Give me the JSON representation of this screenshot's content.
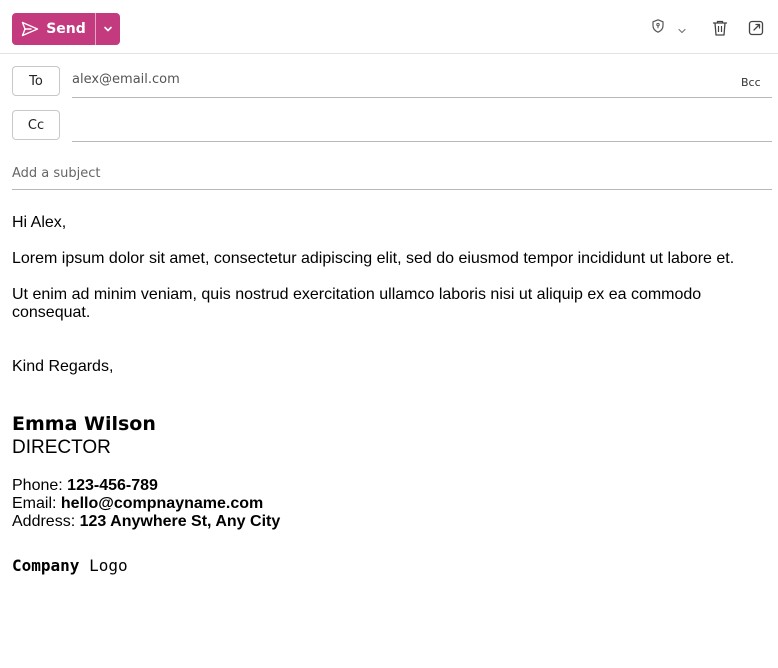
{
  "toolbar": {
    "send_label": "Send",
    "icons": [
      "send-icon",
      "chevron-down-icon",
      "shield-icon",
      "chevron-down-icon",
      "trash-icon",
      "popout-icon"
    ],
    "accent_color": "#c43a7f"
  },
  "recipients": {
    "to_label": "To",
    "to_value": "alex@email.com",
    "cc_label": "Cc",
    "cc_value": "",
    "bcc_label": "Bcc"
  },
  "subject": {
    "placeholder": "Add a subject"
  },
  "body": {
    "greeting": "Hi Alex,",
    "paragraph1": "Lorem ipsum dolor sit amet, consectetur adipiscing elit, sed do eiusmod tempor incididunt ut labore et.",
    "paragraph2": "Ut enim ad minim veniam, quis nostrud exercitation ullamco laboris nisi ut aliquip ex ea commodo consequat.",
    "closing": "Kind Regards,"
  },
  "signature": {
    "name": "Emma Wilson",
    "title": "DIRECTOR",
    "phone_label": "Phone:",
    "phone": "123-456-789",
    "email_label": "Email:",
    "email": "hello@compnayname.com",
    "address_label": "Address:",
    "address": "123 Anywhere St, Any City",
    "logo_bold": "Company",
    "logo_regular": "Logo"
  }
}
